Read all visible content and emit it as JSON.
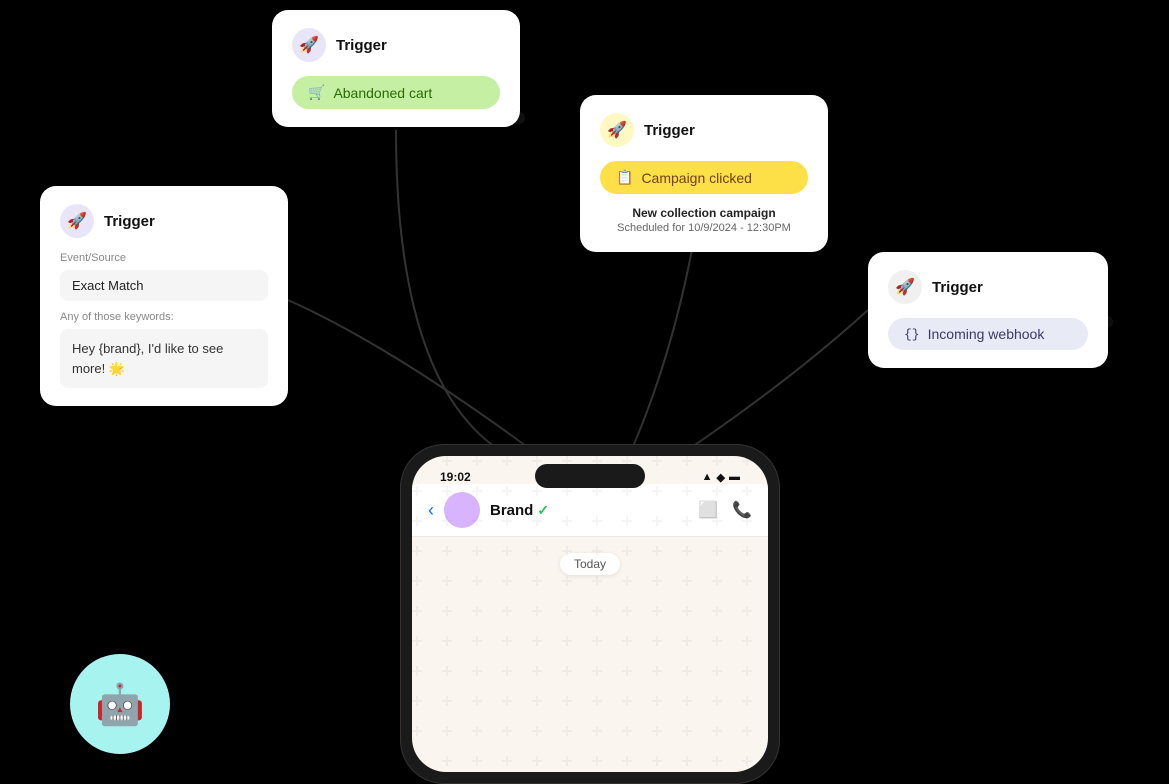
{
  "cards": {
    "abandoned": {
      "title": "Trigger",
      "pill_label": "Abandoned cart",
      "icon": "🚀",
      "pill_icon": "🛒"
    },
    "campaign": {
      "title": "Trigger",
      "pill_label": "Campaign clicked",
      "icon": "🚀",
      "pill_icon": "📋",
      "sub_title": "New collection campaign",
      "sub_date": "Scheduled for 10/9/2024 - 12:30PM"
    },
    "exact_match": {
      "title": "Trigger",
      "icon": "🚀",
      "event_label": "Event/Source",
      "event_value": "Exact Match",
      "keywords_label": "Any of those keywords:",
      "keywords_value": "Hey {brand}, I'd like to see more! 🌟"
    },
    "webhook": {
      "title": "Trigger",
      "icon": "🚀",
      "pill_label": "Incoming webhook",
      "pill_icon": "{}"
    }
  },
  "phone": {
    "time": "19:02",
    "contact_name": "Brand",
    "today_label": "Today",
    "status_icons": "▲ ◆ ▬"
  },
  "mascot": {
    "emoji": "🤖"
  }
}
